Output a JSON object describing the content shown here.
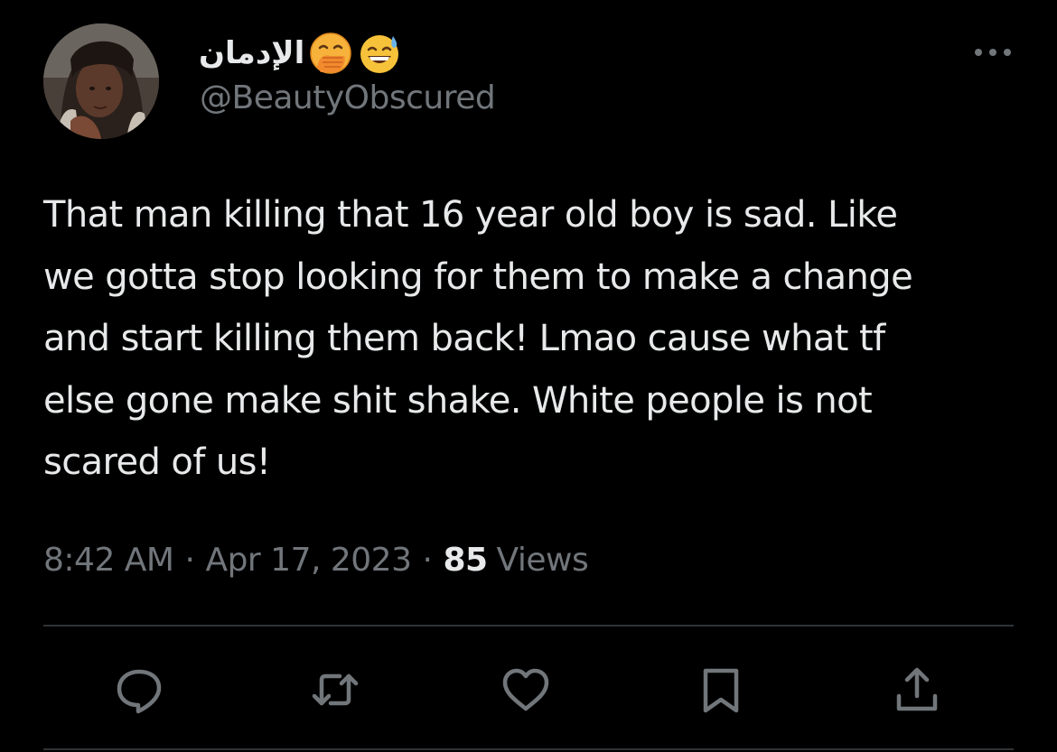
{
  "author": {
    "display_name": "الإدمان",
    "display_emojis": [
      "face-with-hand-over-mouth-emoji",
      "grinning-face-with-sweat-emoji"
    ],
    "handle": "@BeautyObscured",
    "avatar": "profile-photo"
  },
  "tweet": {
    "text": "That man killing that 16 year old boy is sad. Like\nwe gotta stop looking for them to make a change\nand start killing them back! Lmao cause what tf\nelse gone make shit shake. White people is not\nscared of us!",
    "time": "8:42 AM",
    "separator": "·",
    "date": "Apr 17, 2023",
    "views_count": "85",
    "views_label": "Views"
  },
  "actions": {
    "reply_icon": "reply-icon",
    "retweet_icon": "retweet-icon",
    "like_icon": "heart-icon",
    "bookmark_icon": "bookmark-icon",
    "share_icon": "share-icon"
  },
  "colors": {
    "background": "#000000",
    "primary_text": "#e7e9ea",
    "secondary_text": "#71767b",
    "divider": "#2f3336"
  }
}
